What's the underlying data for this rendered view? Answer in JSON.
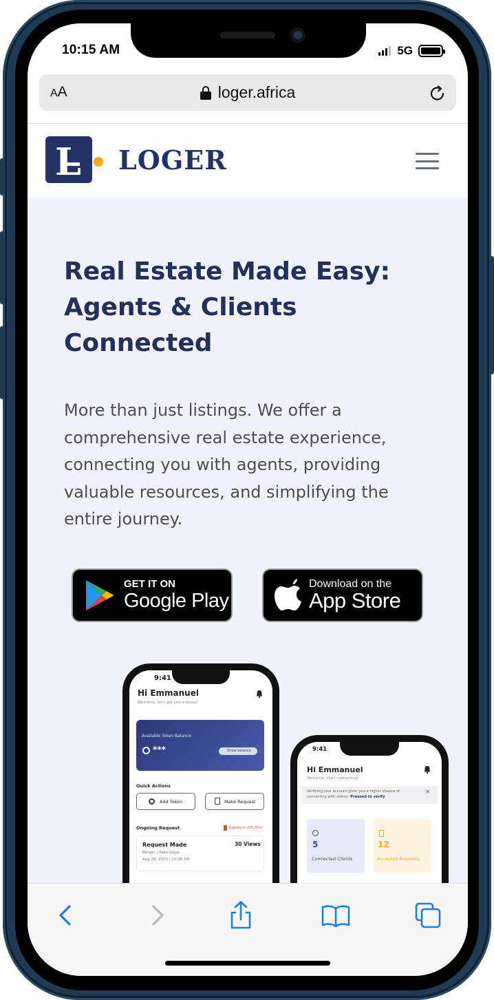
{
  "status_bar": {
    "time": "10:15 AM",
    "network": "5G"
  },
  "browser": {
    "text_size_small": "A",
    "text_size_large": "A",
    "url": "loger.africa"
  },
  "site": {
    "brand_letter": "L",
    "brand_name": "LOGER"
  },
  "hero": {
    "title": "Real Estate Made Easy: Agents & Clients Connected",
    "subtitle": "More than just listings. We offer a comprehensive real estate experience, connecting you with agents, providing valuable resources, and simplifying the entire journey."
  },
  "stores": {
    "google": {
      "small": "GET IT ON",
      "big": "Google Play"
    },
    "apple": {
      "small": "Download on the",
      "big": "App Store"
    }
  },
  "mockup_left": {
    "time": "9:41",
    "greeting": "Hi Emmanuel",
    "welcome": "Welcome, let's get you a house!",
    "token_label": "Available Token Balance",
    "token_value": "***",
    "show_balance": "Show balance",
    "quick_actions": "Quick Actions",
    "add_token": "Add Token",
    "make_request": "Make Request",
    "ongoing_request": "Ongoing Request",
    "expires": "Expires in 23h 05m",
    "request_title": "Request Made",
    "views": "30 Views",
    "location": "Berger | Ifako-Ijaiye",
    "date": "Aug 28, 2023 | 10:36 AM"
  },
  "mockup_right": {
    "time": "9:41",
    "greeting": "Hi Emmanuel",
    "welcome": "Welcome, start connecting!",
    "verify_text": "Verifying your account gives you a higher chance of connecting with clients.",
    "verify_link": "Proceed to verify",
    "close": "×",
    "stat1_value": "5",
    "stat1_label": "Connected Clients",
    "stat2_value": "12",
    "stat2_label": "Accepted Requests"
  },
  "colors": {
    "brand_navy": "#233364",
    "brand_orange": "#f4a81d",
    "hero_bg": "#f1f2fb",
    "ios_blue": "#1a7cf5"
  },
  "icons": [
    "lock-icon",
    "reload-icon",
    "hamburger-menu-icon",
    "google-play-icon",
    "apple-icon",
    "back-icon",
    "forward-icon",
    "share-icon",
    "bookmarks-icon",
    "tabs-icon"
  ]
}
